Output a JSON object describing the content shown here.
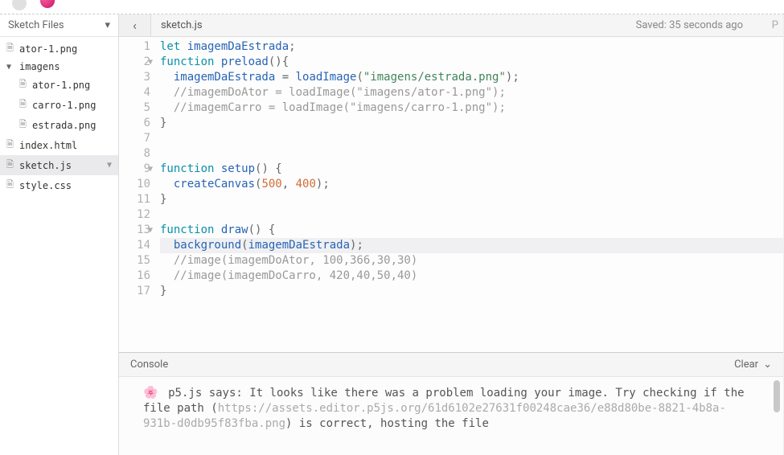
{
  "sidebar": {
    "title": "Sketch Files",
    "items": [
      {
        "name": "ator-1.png",
        "type": "file",
        "depth": 0
      },
      {
        "name": "imagens",
        "type": "folder",
        "depth": 0
      },
      {
        "name": "ator-1.png",
        "type": "file",
        "depth": 1
      },
      {
        "name": "carro-1.png",
        "type": "file",
        "depth": 1
      },
      {
        "name": "estrada.png",
        "type": "file",
        "depth": 1
      },
      {
        "name": "index.html",
        "type": "file",
        "depth": 0
      },
      {
        "name": "sketch.js",
        "type": "file",
        "depth": 0,
        "selected": true
      },
      {
        "name": "style.css",
        "type": "file",
        "depth": 0
      }
    ]
  },
  "tabBar": {
    "back": "‹",
    "fileName": "sketch.js",
    "saveStatus": "Saved: 35 seconds ago",
    "rightCut": "P"
  },
  "code": {
    "lines": [
      {
        "n": 1,
        "segs": [
          [
            "kw",
            "let "
          ],
          [
            "ident",
            "imagemDaEstrada"
          ],
          [
            "op",
            ";"
          ]
        ]
      },
      {
        "n": 2,
        "fold": true,
        "segs": [
          [
            "kw",
            "function "
          ],
          [
            "fn",
            "preload"
          ],
          [
            "op",
            "(){"
          ]
        ]
      },
      {
        "n": 3,
        "segs": [
          [
            "op",
            "  "
          ],
          [
            "ident",
            "imagemDaEstrada"
          ],
          [
            "op",
            " = "
          ],
          [
            "fn",
            "loadImage"
          ],
          [
            "op",
            "("
          ],
          [
            "str",
            "\"imagens/estrada.png\""
          ],
          [
            "op",
            ");"
          ]
        ]
      },
      {
        "n": 4,
        "segs": [
          [
            "op",
            "  "
          ],
          [
            "com",
            "//imagemDoAtor = loadImage(\"imagens/ator-1.png\");"
          ]
        ]
      },
      {
        "n": 5,
        "segs": [
          [
            "op",
            "  "
          ],
          [
            "com",
            "//imagemCarro = loadImage(\"imagens/carro-1.png\");"
          ]
        ]
      },
      {
        "n": 6,
        "segs": [
          [
            "op",
            "}"
          ]
        ]
      },
      {
        "n": 7,
        "segs": []
      },
      {
        "n": 8,
        "segs": []
      },
      {
        "n": 9,
        "fold": true,
        "segs": [
          [
            "kw",
            "function "
          ],
          [
            "fn",
            "setup"
          ],
          [
            "op",
            "() {"
          ]
        ]
      },
      {
        "n": 10,
        "segs": [
          [
            "op",
            "  "
          ],
          [
            "fn",
            "createCanvas"
          ],
          [
            "op",
            "("
          ],
          [
            "num",
            "500"
          ],
          [
            "op",
            ", "
          ],
          [
            "num",
            "400"
          ],
          [
            "op",
            ");"
          ]
        ]
      },
      {
        "n": 11,
        "segs": [
          [
            "op",
            "}"
          ]
        ]
      },
      {
        "n": 12,
        "segs": []
      },
      {
        "n": 13,
        "fold": true,
        "segs": [
          [
            "kw",
            "function "
          ],
          [
            "fn",
            "draw"
          ],
          [
            "op",
            "() {"
          ]
        ]
      },
      {
        "n": 14,
        "current": true,
        "segs": [
          [
            "op",
            "  "
          ],
          [
            "fn",
            "background"
          ],
          [
            "op",
            "("
          ],
          [
            "ident",
            "imagemDaEstrada"
          ],
          [
            "op",
            ");"
          ]
        ]
      },
      {
        "n": 15,
        "segs": [
          [
            "op",
            "  "
          ],
          [
            "com",
            "//image(imagemDoAtor, 100,366,30,30)"
          ]
        ]
      },
      {
        "n": 16,
        "segs": [
          [
            "op",
            "  "
          ],
          [
            "com",
            "//image(imagemDoCarro, 420,40,50,40)"
          ]
        ]
      },
      {
        "n": 17,
        "segs": [
          [
            "op",
            "}"
          ]
        ]
      }
    ]
  },
  "console": {
    "title": "Console",
    "clear": "Clear",
    "flower": "🌸",
    "msgPre": " p5.js says: It looks like there was a problem loading your image. Try checking if the file path (",
    "msgUrl": "https://assets.editor.p5js.org/61d6102e27631f00248cae36/e88d80be-8821-4b8a-931b-d0db95f83fba.png",
    "msgPost": ") is correct, hosting the file"
  }
}
